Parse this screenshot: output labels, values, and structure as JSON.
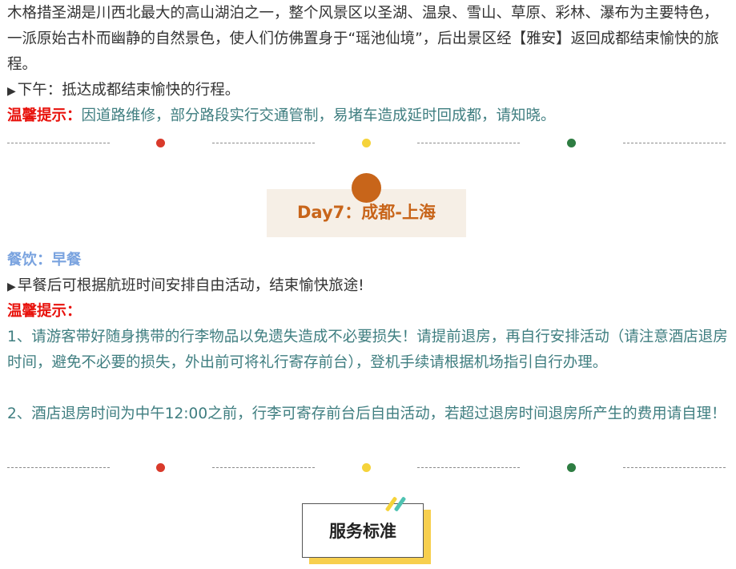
{
  "intro": {
    "paragraph": "木格措圣湖是川西北最大的高山湖泊之一，整个风景区以圣湖、温泉、雪山、草原、彩林、瀑布为主要特色，一派原始古朴而幽静的自然景色，使人们仿佛置身于“瑶池仙境”，后出景区经【雅安】返回成都结束愉快的旅程。",
    "afternoon_arrow": "▶",
    "afternoon": "下午：抵达成都结束愉快的行程。",
    "tip_label": "温馨提示：",
    "tip_text": "因道路维修，部分路段实行交通管制，易堵车造成延时回成都，请知晓。"
  },
  "divider_colors": [
    "#d93a2b",
    "#f5d33a",
    "#2e7d42"
  ],
  "day7": {
    "title": "Day7：成都-上海",
    "meals_label": "餐饮：早餐",
    "activity_arrow": "▶",
    "activity": "早餐后可根据航班时间安排自由活动，结束愉快旅途!",
    "tip_label": "温馨提示：",
    "tip_1": "1、请游客带好随身携带的行李物品以免遗失造成不必要损失！请提前退房，再自行安排活动（请注意酒店退房时间，避免不必要的损失，外出前可将礼行寄存前台），登机手续请根据机场指引自行办理。",
    "tip_2": "2、酒店退房时间为中午12:00之前，行李可寄存前台后自由活动，若超过退房时间退房所产生的费用请自理！"
  },
  "service": {
    "title": "服务标准"
  },
  "colors": {
    "accent_orange": "#c8651a",
    "tip_red": "#e8120c",
    "meal_blue": "#7aa3df",
    "teal_text": "#3f7e80",
    "yellow_shadow": "#f7cf4e",
    "stripe_teal": "#4fc3b2"
  }
}
